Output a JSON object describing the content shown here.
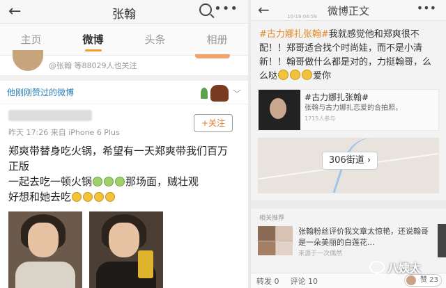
{
  "left": {
    "title": "张翰",
    "tabs": [
      "主页",
      "微博",
      "头条",
      "相册"
    ],
    "active_tab": 1,
    "follow_line": "@张翰 等88029人也关注",
    "liked_label": "他刚刚赞过的微博",
    "post": {
      "meta": "昨天 17:26  来自 iPhone 6 Plus",
      "follow_button": "+关注",
      "line1": "郑爽带替身吃火锅，希望有一天郑爽带我们百万",
      "line2": "正版",
      "line3a": "一起去吃一顿火锅",
      "line3b": "那场面，贼壮观",
      "line4": " 好想和她去吃"
    }
  },
  "right": {
    "title": "微博正文",
    "timestamp": "10-19 04:59",
    "text_tag": "#古力娜扎张翰#",
    "text_body1": "我就感觉他和郑爽很不配！！郑哥适合找个时尚娃，而不是小清新！！翰哥做什么都是对的，力挺翰哥，么么哒",
    "text_body2": "爱你",
    "card_hash": "#古力娜扎张翰#",
    "card_sub": "张翰与古力娜扎恋爱的合拍照，",
    "card_small": "1715人参与",
    "map_label": "306街道",
    "related_label": "相关推荐",
    "related_text": "张翰粉丝评价我文章太惊艳，还说翰哥是一朵美丽的白莲花...",
    "related_src": "来源于一次偶然",
    "bottom_repost": "转发 0",
    "bottom_comment": "评论 10",
    "like_label": "赞 23"
  },
  "watermark": "八姨太"
}
